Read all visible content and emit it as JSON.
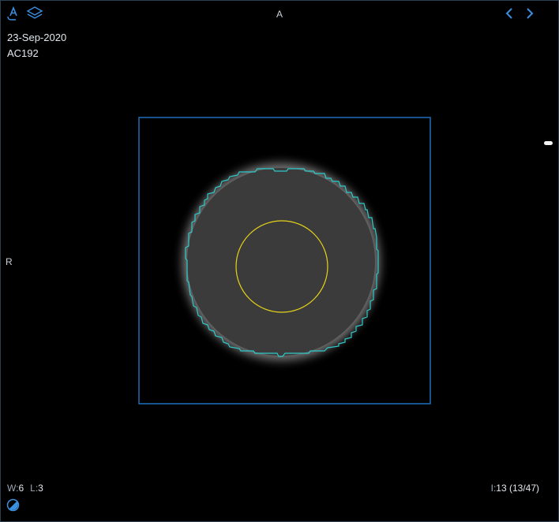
{
  "toolbar": {
    "annotate_icon": "annotation-tool-icon",
    "layers_icon": "layers-icon"
  },
  "navigation": {
    "prev_icon": "chevron-left-icon",
    "next_icon": "chevron-right-icon"
  },
  "orientation": {
    "top": "A",
    "left": "R"
  },
  "study": {
    "date": "23-Sep-2020",
    "id": "AC192"
  },
  "window": {
    "w_label": "W:",
    "w_value": "6",
    "l_label": "L:",
    "l_value": "3"
  },
  "image_index": {
    "label": "I:",
    "value": "13 (13/47)"
  },
  "colors": {
    "accent": "#3b8fe0",
    "roi_box": "#1e6fb8",
    "contour": "#2ec9c9",
    "circle_roi": "#e6d21a",
    "background": "#000000"
  }
}
